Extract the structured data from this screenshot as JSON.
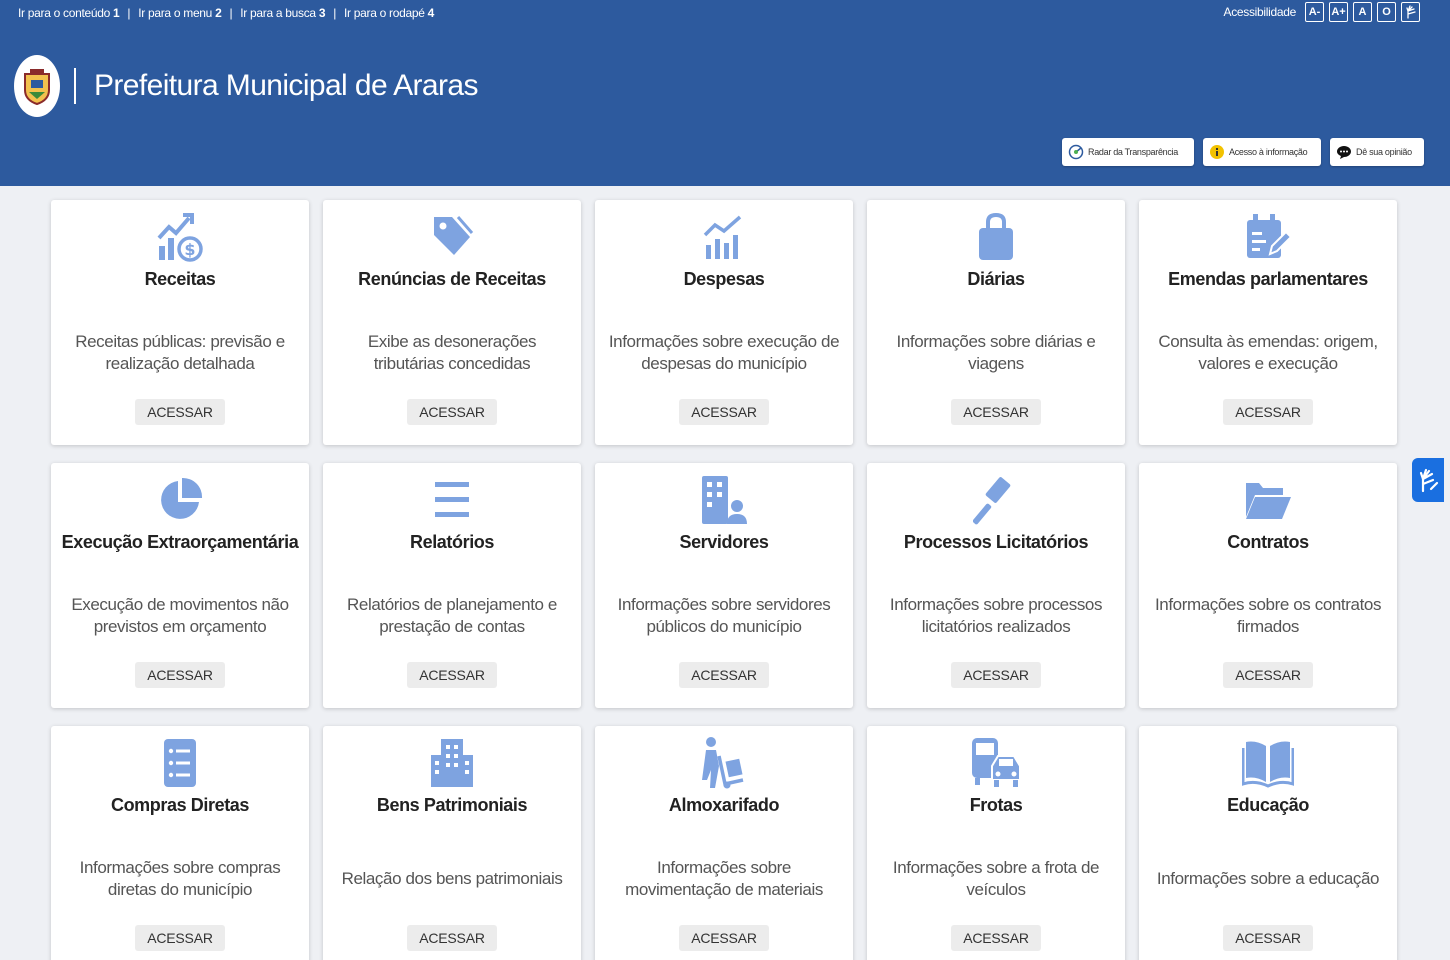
{
  "header": {
    "skip_links": [
      {
        "label": "Ir para o conteúdo",
        "key": "1"
      },
      {
        "label": "Ir para o menu",
        "key": "2"
      },
      {
        "label": "Ir para a busca",
        "key": "3"
      },
      {
        "label": "Ir para o rodapé",
        "key": "4"
      }
    ],
    "accessibility": {
      "label": "Acessibilidade",
      "buttons": [
        "A-",
        "A+",
        "A",
        "O"
      ]
    },
    "title": "Prefeitura Municipal de Araras",
    "quick_links": [
      "Radar da Transparência",
      "Acesso à informação",
      "Dê sua opinião"
    ]
  },
  "colors": {
    "header_bg": "#2d5a9e",
    "icon": "#7ea3e0",
    "page_bg": "#eef0f4"
  },
  "cards": [
    {
      "title": "Receitas",
      "desc": "Receitas públicas: previsão e realização detalhada",
      "button": "ACESSAR",
      "icon": "revenue-chart-icon"
    },
    {
      "title": "Renúncias de Receitas",
      "desc": "Exibe as desonerações tributárias concedidas",
      "button": "ACESSAR",
      "icon": "tags-icon"
    },
    {
      "title": "Despesas",
      "desc": "Informações sobre execução de despesas do município",
      "button": "ACESSAR",
      "icon": "chart-line-icon"
    },
    {
      "title": "Diárias",
      "desc": "Informações sobre diárias e viagens",
      "button": "ACESSAR",
      "icon": "shopping-bag-icon"
    },
    {
      "title": "Emendas parlamentares",
      "desc": "Consulta às emendas: origem, valores e execução",
      "button": "ACESSAR",
      "icon": "calendar-edit-icon"
    },
    {
      "title": "Execução Extraorçamentária",
      "desc": "Execução de movimentos não previstos em orçamento",
      "button": "ACESSAR",
      "icon": "pie-chart-icon"
    },
    {
      "title": "Relatórios",
      "desc": "Relatórios de planejamento e prestação de contas",
      "button": "ACESSAR",
      "icon": "menu-lines-icon"
    },
    {
      "title": "Servidores",
      "desc": "Informações sobre servidores públicos do município",
      "button": "ACESSAR",
      "icon": "building-user-icon"
    },
    {
      "title": "Processos Licitatórios",
      "desc": "Informações sobre processos licitatórios realizados",
      "button": "ACESSAR",
      "icon": "gavel-icon"
    },
    {
      "title": "Contratos",
      "desc": "Informações sobre os contratos firmados",
      "button": "ACESSAR",
      "icon": "folder-open-icon"
    },
    {
      "title": "Compras Diretas",
      "desc": "Informações sobre compras diretas do município",
      "button": "ACESSAR",
      "icon": "list-document-icon"
    },
    {
      "title": "Bens Patrimoniais",
      "desc": "Relação dos bens patrimoniais",
      "button": "ACESSAR",
      "icon": "building-icon"
    },
    {
      "title": "Almoxarifado",
      "desc": "Informações sobre movimentação de materiais",
      "button": "ACESSAR",
      "icon": "person-dolly-icon"
    },
    {
      "title": "Frotas",
      "desc": "Informações sobre a frota de veículos",
      "button": "ACESSAR",
      "icon": "vehicles-icon"
    },
    {
      "title": "Educação",
      "desc": "Informações sobre a educação",
      "button": "ACESSAR",
      "icon": "open-book-icon"
    }
  ]
}
